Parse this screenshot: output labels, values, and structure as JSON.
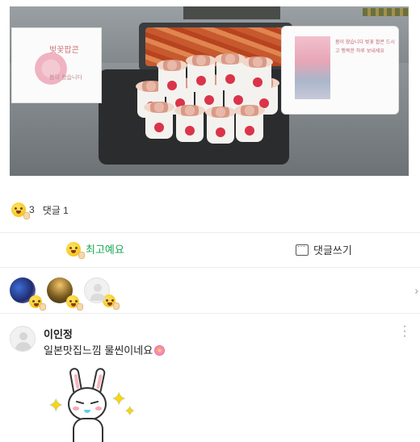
{
  "post_photo": {
    "left_card_title": "벚꽃팝콘",
    "left_card_subtitle": "봄이 왔습니다",
    "right_card_text": "봄이 왔습니다 벚꽃 팝콘 드시고 행복한 하루 보내세요"
  },
  "reactions": {
    "emoji": "laughing-face-icon",
    "count": "3",
    "comments_label": "댓글 1"
  },
  "actions": {
    "like_label": "최고예요",
    "comment_label": "댓글쓰기"
  },
  "reactors": [
    {
      "name": "reactor-1",
      "emoji": "laughing-face-icon"
    },
    {
      "name": "reactor-2",
      "emoji": "laughing-face-icon"
    },
    {
      "name": "reactor-3",
      "emoji": "laughing-face-icon"
    }
  ],
  "comment": {
    "author": "이인정",
    "text": "일본맛집느낌 물씬이네요",
    "emoji": "cherry-blossom-icon",
    "sticker": "sparkle-bunny-sticker"
  },
  "colors": {
    "accent_green": "#17a84f",
    "divider": "#ececec"
  }
}
